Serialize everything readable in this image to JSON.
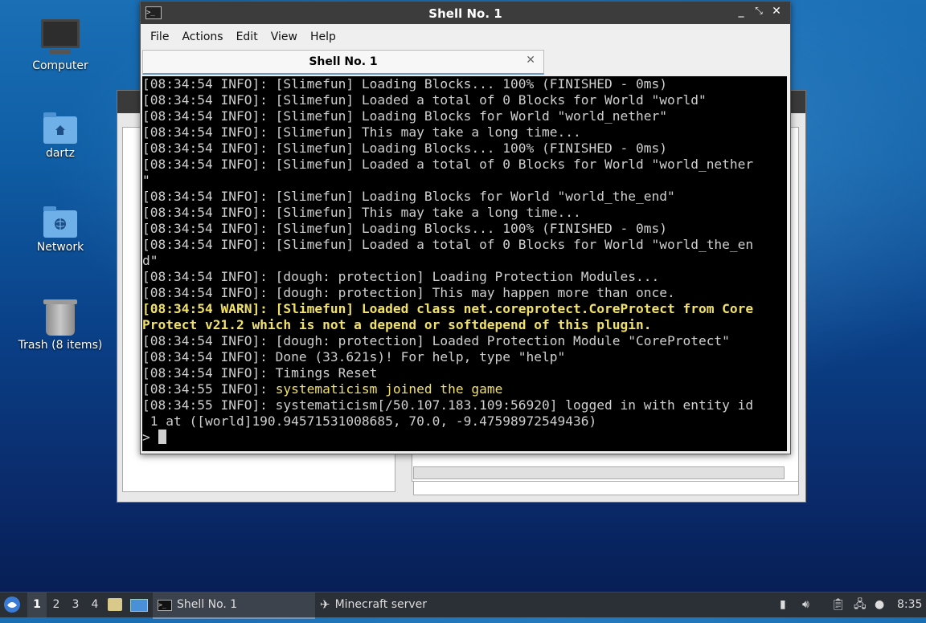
{
  "desktop": {
    "icons": [
      {
        "label": "Computer"
      },
      {
        "label": "dartz"
      },
      {
        "label": "Network"
      },
      {
        "label": "Trash (8 items)"
      }
    ]
  },
  "terminal": {
    "title": "Shell No. 1",
    "menu": [
      "File",
      "Actions",
      "Edit",
      "View",
      "Help"
    ],
    "tab_label": "Shell No. 1",
    "lines": [
      {
        "text": "[08:34:54 INFO]: [Slimefun] Loading Blocks... 100% (FINISHED - 0ms)",
        "style": "normal"
      },
      {
        "text": "[08:34:54 INFO]: [Slimefun] Loaded a total of 0 Blocks for World \"world\"",
        "style": "normal"
      },
      {
        "text": "[08:34:54 INFO]: [Slimefun] Loading Blocks for World \"world_nether\"",
        "style": "normal"
      },
      {
        "text": "[08:34:54 INFO]: [Slimefun] This may take a long time...",
        "style": "normal"
      },
      {
        "text": "[08:34:54 INFO]: [Slimefun] Loading Blocks... 100% (FINISHED - 0ms)",
        "style": "normal"
      },
      {
        "text": "[08:34:54 INFO]: [Slimefun] Loaded a total of 0 Blocks for World \"world_nether",
        "style": "normal"
      },
      {
        "text": "\"",
        "style": "normal"
      },
      {
        "text": "[08:34:54 INFO]: [Slimefun] Loading Blocks for World \"world_the_end\"",
        "style": "normal"
      },
      {
        "text": "[08:34:54 INFO]: [Slimefun] This may take a long time...",
        "style": "normal"
      },
      {
        "text": "[08:34:54 INFO]: [Slimefun] Loading Blocks... 100% (FINISHED - 0ms)",
        "style": "normal"
      },
      {
        "text": "[08:34:54 INFO]: [Slimefun] Loaded a total of 0 Blocks for World \"world_the_en",
        "style": "normal"
      },
      {
        "text": "d\"",
        "style": "normal"
      },
      {
        "text": "[08:34:54 INFO]: [dough: protection] Loading Protection Modules...",
        "style": "normal"
      },
      {
        "text": "[08:34:54 INFO]: [dough: protection] This may happen more than once.",
        "style": "normal"
      },
      {
        "text": "[08:34:54 WARN]: [Slimefun] Loaded class net.coreprotect.CoreProtect from Core",
        "style": "warn"
      },
      {
        "text": "Protect v21.2 which is not a depend or softdepend of this plugin.",
        "style": "warn"
      },
      {
        "text": "[08:34:54 INFO]: [dough: protection] Loaded Protection Module \"CoreProtect\"",
        "style": "normal"
      },
      {
        "text": "[08:34:54 INFO]: Done (33.621s)! For help, type \"help\"",
        "style": "normal"
      },
      {
        "text": "[08:34:54 INFO]: Timings Reset",
        "style": "normal"
      },
      {
        "text": "[08:34:55 INFO]: ",
        "highlight": "systematicism joined the game",
        "style": "normal"
      },
      {
        "text": "[08:34:55 INFO]: systematicism[/50.107.183.109:56920] logged in with entity id",
        "style": "normal"
      },
      {
        "text": " 1 at ([world]190.94571531008685, 70.0, -9.47598972549436)",
        "style": "normal"
      }
    ],
    "prompt": ">"
  },
  "taskbar": {
    "workspaces": [
      "1",
      "2",
      "3",
      "4"
    ],
    "tasks": [
      {
        "label": "Shell No. 1"
      },
      {
        "label": "Minecraft server"
      }
    ],
    "clock": "8:35"
  },
  "colors": {
    "warn": "#f1e267",
    "console_bg": "#000000",
    "console_fg": "#cfcfcf"
  }
}
